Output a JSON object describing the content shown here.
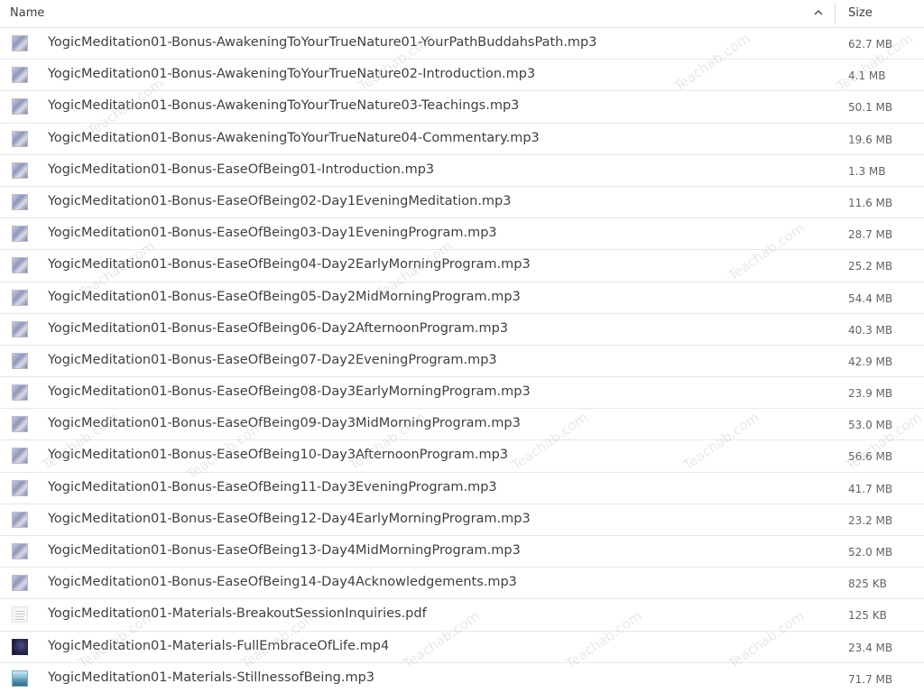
{
  "header": {
    "name_label": "Name",
    "size_label": "Size",
    "sort_icon": "chevron-up-icon"
  },
  "watermark": "Teachab.com",
  "files": [
    {
      "name": "YogicMeditation01-Bonus-AwakeningToYourTrueNature01-YourPathBuddahsPath.mp3",
      "size": "62.7 MB",
      "icon": "audio-thumbnail-icon"
    },
    {
      "name": "YogicMeditation01-Bonus-AwakeningToYourTrueNature02-Introduction.mp3",
      "size": "4.1 MB",
      "icon": "audio-thumbnail-icon"
    },
    {
      "name": "YogicMeditation01-Bonus-AwakeningToYourTrueNature03-Teachings.mp3",
      "size": "50.1 MB",
      "icon": "audio-thumbnail-icon"
    },
    {
      "name": "YogicMeditation01-Bonus-AwakeningToYourTrueNature04-Commentary.mp3",
      "size": "19.6 MB",
      "icon": "audio-thumbnail-icon"
    },
    {
      "name": "YogicMeditation01-Bonus-EaseOfBeing01-Introduction.mp3",
      "size": "1.3 MB",
      "icon": "audio-thumbnail-icon"
    },
    {
      "name": "YogicMeditation01-Bonus-EaseOfBeing02-Day1EveningMeditation.mp3",
      "size": "11.6 MB",
      "icon": "audio-thumbnail-icon"
    },
    {
      "name": "YogicMeditation01-Bonus-EaseOfBeing03-Day1EveningProgram.mp3",
      "size": "28.7 MB",
      "icon": "audio-thumbnail-icon"
    },
    {
      "name": "YogicMeditation01-Bonus-EaseOfBeing04-Day2EarlyMorningProgram.mp3",
      "size": "25.2 MB",
      "icon": "audio-thumbnail-icon"
    },
    {
      "name": "YogicMeditation01-Bonus-EaseOfBeing05-Day2MidMorningProgram.mp3",
      "size": "54.4 MB",
      "icon": "audio-thumbnail-icon"
    },
    {
      "name": "YogicMeditation01-Bonus-EaseOfBeing06-Day2AfternoonProgram.mp3",
      "size": "40.3 MB",
      "icon": "audio-thumbnail-icon"
    },
    {
      "name": "YogicMeditation01-Bonus-EaseOfBeing07-Day2EveningProgram.mp3",
      "size": "42.9 MB",
      "icon": "audio-thumbnail-icon"
    },
    {
      "name": "YogicMeditation01-Bonus-EaseOfBeing08-Day3EarlyMorningProgram.mp3",
      "size": "23.9 MB",
      "icon": "audio-thumbnail-icon"
    },
    {
      "name": "YogicMeditation01-Bonus-EaseOfBeing09-Day3MidMorningProgram.mp3",
      "size": "53.0 MB",
      "icon": "audio-thumbnail-icon"
    },
    {
      "name": "YogicMeditation01-Bonus-EaseOfBeing10-Day3AfternoonProgram.mp3",
      "size": "56.6 MB",
      "icon": "audio-thumbnail-icon"
    },
    {
      "name": "YogicMeditation01-Bonus-EaseOfBeing11-Day3EveningProgram.mp3",
      "size": "41.7 MB",
      "icon": "audio-thumbnail-icon"
    },
    {
      "name": "YogicMeditation01-Bonus-EaseOfBeing12-Day4EarlyMorningProgram.mp3",
      "size": "23.2 MB",
      "icon": "audio-thumbnail-icon"
    },
    {
      "name": "YogicMeditation01-Bonus-EaseOfBeing13-Day4MidMorningProgram.mp3",
      "size": "52.0 MB",
      "icon": "audio-thumbnail-icon"
    },
    {
      "name": "YogicMeditation01-Bonus-EaseOfBeing14-Day4Acknowledgements.mp3",
      "size": "825 KB",
      "icon": "audio-thumbnail-icon"
    },
    {
      "name": "YogicMeditation01-Materials-BreakoutSessionInquiries.pdf",
      "size": "125 KB",
      "icon": "pdf-thumbnail-icon"
    },
    {
      "name": "YogicMeditation01-Materials-FullEmbraceOfLife.mp4",
      "size": "23.4 MB",
      "icon": "video-thumbnail-icon"
    },
    {
      "name": "YogicMeditation01-Materials-StillnessofBeing.mp3",
      "size": "71.7 MB",
      "icon": "landscape-thumbnail-icon"
    }
  ]
}
